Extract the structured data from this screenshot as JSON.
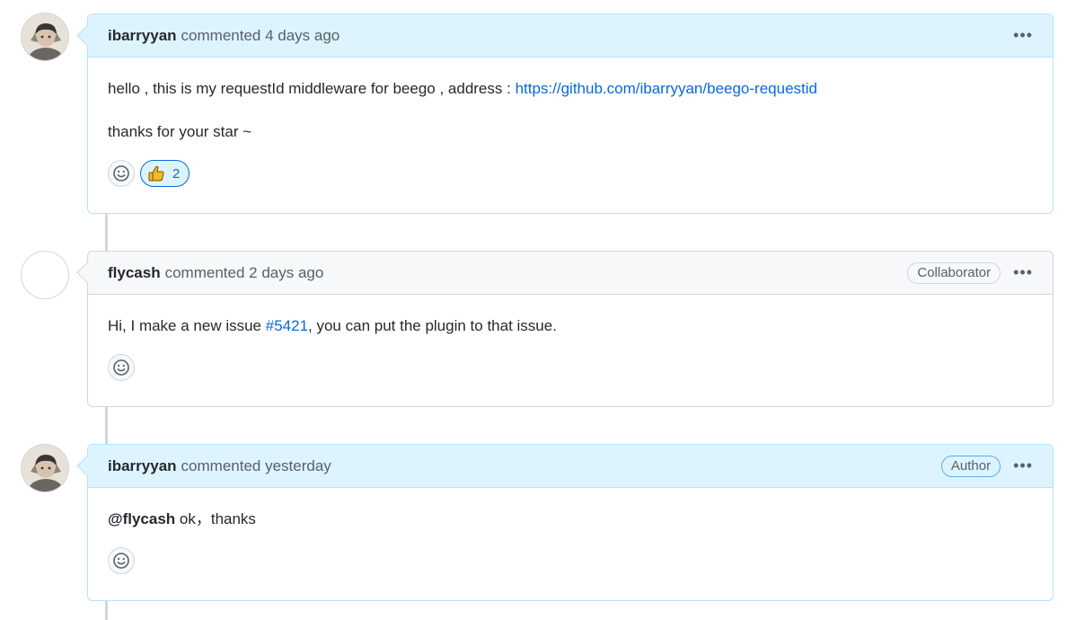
{
  "comments": [
    {
      "author": "ibarryyan",
      "meta": "commented 4 days ago",
      "badge": "",
      "paragraph1_text": "hello , this is my requestId middleware for beego , address : ",
      "paragraph1_link": "https://github.com/ibarryyan/beego-requestid",
      "paragraph2_text": "thanks for your star ~",
      "reaction": {
        "emoji": "thumbs-up",
        "count": "2"
      }
    },
    {
      "author": "flycash",
      "meta": "commented 2 days ago",
      "badge": "Collaborator",
      "text_before": "Hi, I make a new issue ",
      "issue_link": "#5421",
      "text_after": ", you can put the plugin to that issue."
    },
    {
      "author": "ibarryyan",
      "meta": "commented yesterday",
      "badge": "Author",
      "mention": "@flycash",
      "text": " ok，thanks"
    }
  ],
  "kebab_label": "•••",
  "colors": {
    "owner_header": "#ddf4ff",
    "owner_border": "#b6e3ff",
    "link": "#0969da",
    "timeline": "#d0d7de"
  }
}
